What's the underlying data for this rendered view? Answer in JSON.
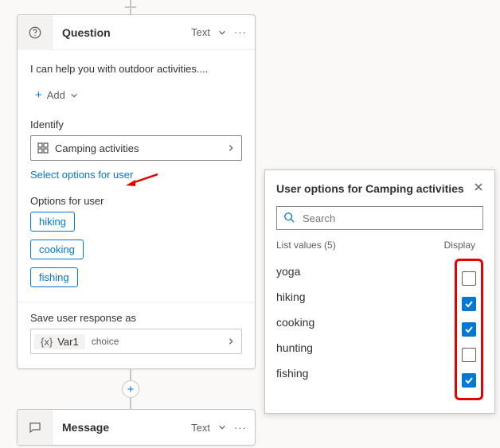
{
  "question_card": {
    "title": "Question",
    "type_label": "Text",
    "prompt_text": "I can help you with outdoor activities....",
    "add_label": "Add",
    "identify_label": "Identify",
    "entity_name": "Camping activities",
    "select_options_link": "Select options for user",
    "options_label": "Options for user",
    "chips": [
      "hiking",
      "cooking",
      "fishing"
    ],
    "save_response_label": "Save user response as",
    "var_name": "Var1",
    "var_type": "choice"
  },
  "message_card": {
    "title": "Message",
    "type_label": "Text"
  },
  "panel": {
    "title": "User options for Camping activities",
    "search_placeholder": "Search",
    "list_values_label": "List values (5)",
    "display_label": "Display",
    "items": [
      {
        "label": "yoga",
        "display": false
      },
      {
        "label": "hiking",
        "display": true
      },
      {
        "label": "cooking",
        "display": true
      },
      {
        "label": "hunting",
        "display": false
      },
      {
        "label": "fishing",
        "display": true
      }
    ]
  }
}
